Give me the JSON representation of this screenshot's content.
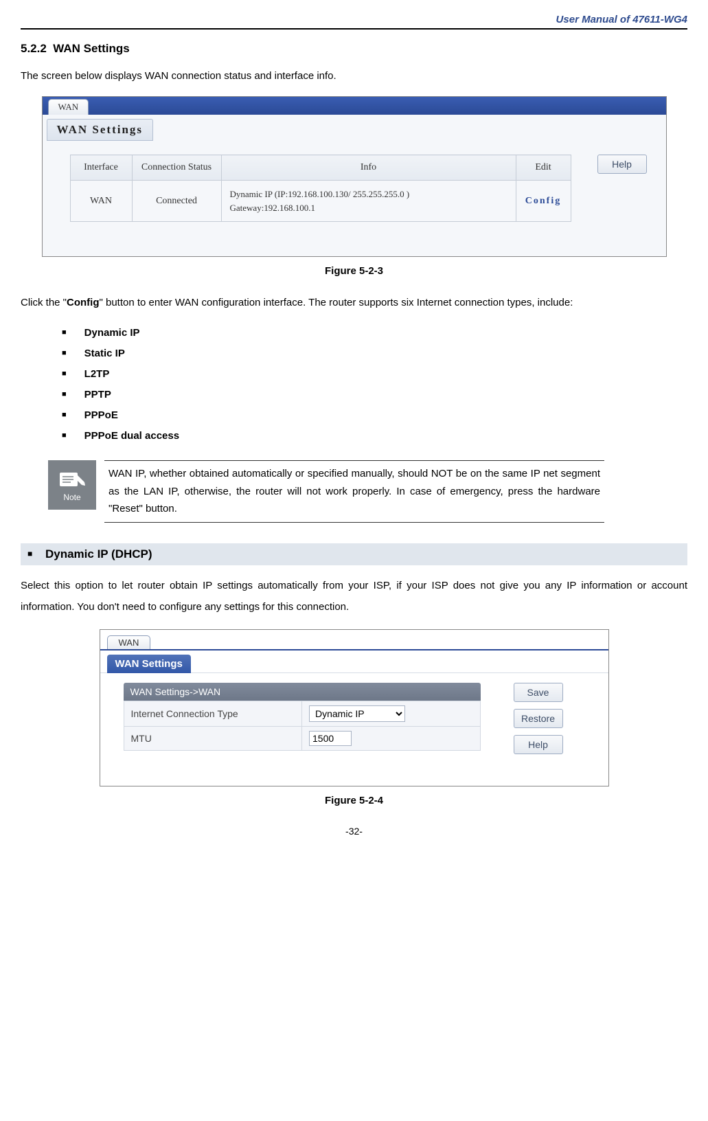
{
  "header": {
    "title": "User Manual of 47611-WG4"
  },
  "section": {
    "number": "5.2.2",
    "title": "WAN Settings",
    "intro": "The screen below displays WAN connection status and interface info."
  },
  "screenshot1": {
    "tab": "WAN",
    "panel_title": "WAN Settings",
    "columns": {
      "interface": "Interface",
      "status": "Connection Status",
      "info": "Info",
      "edit": "Edit"
    },
    "row": {
      "interface": "WAN",
      "status": "Connected",
      "info_line1": "Dynamic IP (IP:192.168.100.130/ 255.255.255.0 )",
      "info_line2": "Gateway:192.168.100.1",
      "config": "Config"
    },
    "help_button": "Help"
  },
  "figure1_caption": "Figure 5-2-3",
  "config_intro_pre": "Click the \"",
  "config_intro_bold": "Config",
  "config_intro_post": "\" button to enter WAN configuration interface. The router supports six Internet connection types, include:",
  "connection_types": [
    "Dynamic IP",
    "Static IP",
    "L2TP",
    "PPTP",
    "PPPoE",
    "PPPoE dual access"
  ],
  "note": {
    "label": "Note",
    "text": "WAN IP, whether obtained automatically or specified manually, should NOT be on the same IP net segment as the LAN IP, otherwise, the router will not work properly. In case of emergency, press the hardware \"Reset\" button."
  },
  "subsection": {
    "title": "Dynamic IP (DHCP)",
    "text": "Select this option to let router obtain IP settings automatically from your ISP, if your ISP does not give you any IP information or account information. You don't need to configure any settings for this connection."
  },
  "screenshot2": {
    "tab": "WAN",
    "panel_title": "WAN Settings",
    "section_header": "WAN Settings->WAN",
    "row1_label": "Internet Connection Type",
    "row1_value": "Dynamic IP",
    "row2_label": "MTU",
    "row2_value": "1500",
    "save_button": "Save",
    "restore_button": "Restore",
    "help_button": "Help"
  },
  "figure2_caption": "Figure 5-2-4",
  "page_number": "-32-"
}
